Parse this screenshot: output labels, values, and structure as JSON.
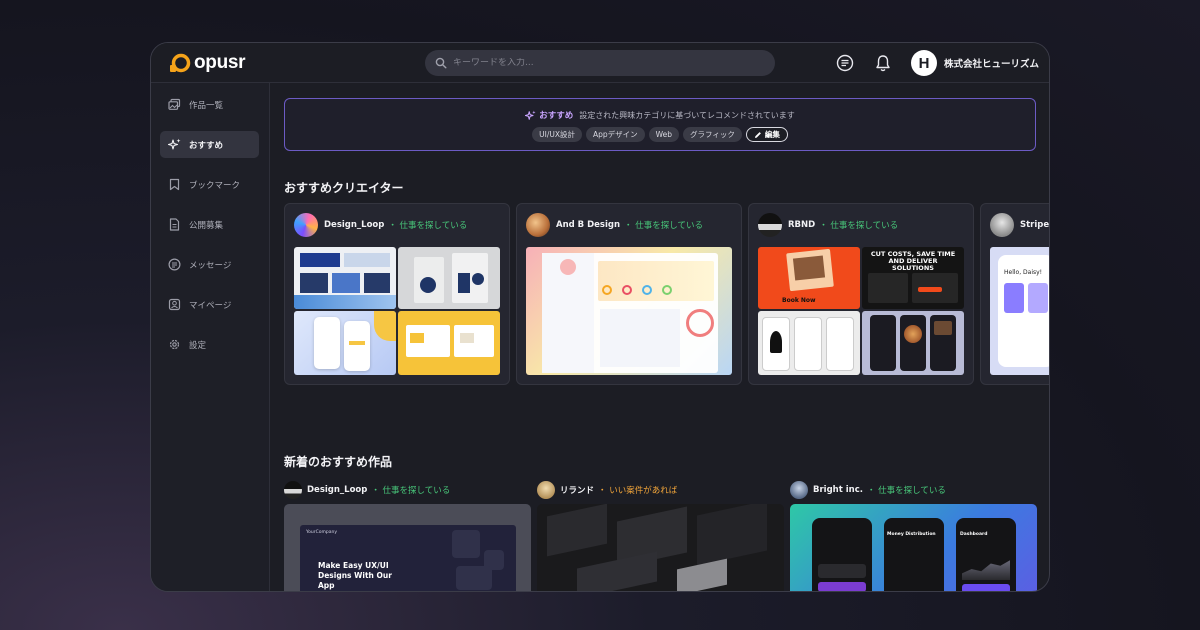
{
  "app": {
    "logo_text": "opusr"
  },
  "header": {
    "search_placeholder": "キーワードを入力...",
    "user_initial": "H",
    "user_name": "株式会社ヒューリズム"
  },
  "sidebar": {
    "items": [
      {
        "label": "作品一覧",
        "icon": "gallery-icon",
        "active": false
      },
      {
        "label": "おすすめ",
        "icon": "sparkle-icon",
        "active": true
      },
      {
        "label": "ブックマーク",
        "icon": "bookmark-icon",
        "active": false
      },
      {
        "label": "公開募集",
        "icon": "document-icon",
        "active": false
      },
      {
        "label": "メッセージ",
        "icon": "message-icon",
        "active": false
      },
      {
        "label": "マイページ",
        "icon": "user-icon",
        "active": false
      },
      {
        "label": "設定",
        "icon": "gear-icon",
        "active": false
      }
    ]
  },
  "recommend": {
    "title": "おすすめ",
    "description": "設定された興味カテゴリに基づいてレコメンドされています",
    "chips": [
      "UI/UX設計",
      "Appデザイン",
      "Web",
      "グラフィック"
    ],
    "edit_label": "編集"
  },
  "creators_section": {
    "title": "おすすめクリエイター",
    "cards": [
      {
        "name": "Design_Loop",
        "status": "・ 仕事を探している"
      },
      {
        "name": "And B Design",
        "status": "・ 仕事を探している"
      },
      {
        "name": "RBND",
        "status": "・ 仕事を探している"
      },
      {
        "name": "Stripe L",
        "status": ""
      }
    ],
    "thumb_text": {
      "cut_costs": "CUT COSTS, SAVE TIME AND DELIVER SOLUTIONS",
      "book_now": "Book Now",
      "hello": "Hello, Daisy!"
    }
  },
  "works_section": {
    "title": "新着のおすすめ作品",
    "items": [
      {
        "name": "Design_Loop",
        "status": "・ 仕事を探している",
        "status_color": "#48c77a"
      },
      {
        "name": "リランド",
        "status": "・ いい案件があれば",
        "status_color": "#f0a43a"
      },
      {
        "name": "Bright inc.",
        "status": "・ 仕事を探している",
        "status_color": "#48c77a"
      }
    ],
    "thumb_text": {
      "headline": "Make Easy UX/UI Designs With Our App",
      "brand": "YourCompany",
      "money": "Money Distribution",
      "dashboard": "Dashboard"
    }
  },
  "colors": {
    "accent": "#6c5bc4",
    "status_green": "#48c77a",
    "status_orange": "#f0a43a",
    "logo_orange": "#f5a31a"
  }
}
